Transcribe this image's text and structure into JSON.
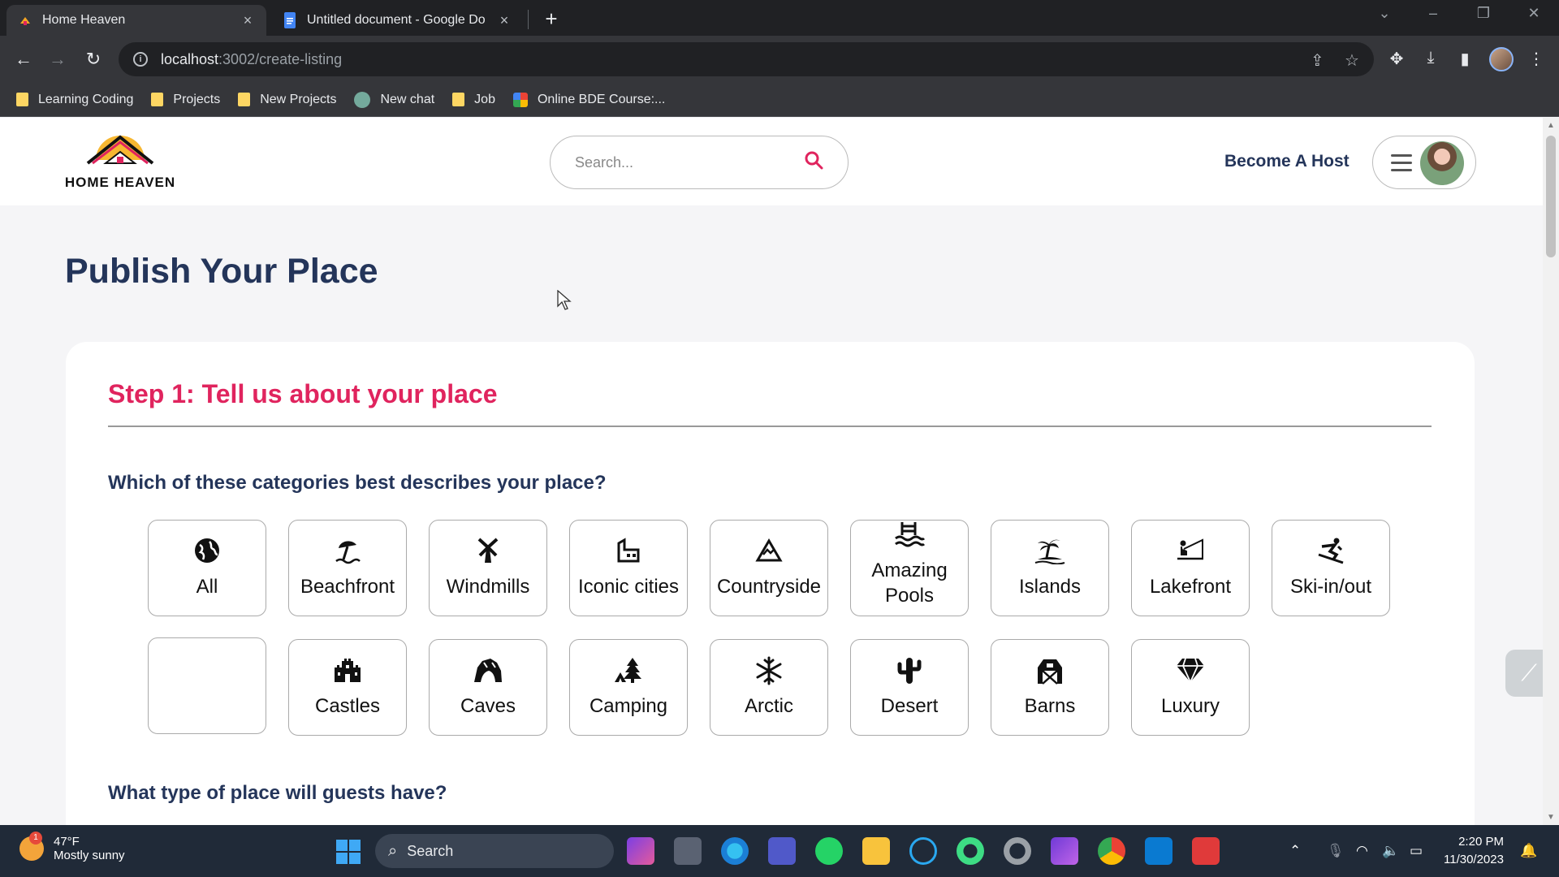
{
  "browser": {
    "tabs": [
      {
        "title": "Home Heaven",
        "active": true
      },
      {
        "title": "Untitled document - Google Do",
        "active": false
      }
    ],
    "url_host": "localhost",
    "url_path": ":3002/create-listing",
    "bookmarks": [
      {
        "label": "Learning Coding",
        "icon": "folder-icon"
      },
      {
        "label": "Projects",
        "icon": "folder-icon"
      },
      {
        "label": "New Projects",
        "icon": "folder-icon"
      },
      {
        "label": "New chat",
        "icon": "chatgpt-icon"
      },
      {
        "label": "Job",
        "icon": "folder-icon"
      },
      {
        "label": "Online BDE Course:...",
        "icon": "google-icon"
      }
    ]
  },
  "header": {
    "brand": "HOME HEAVEN",
    "search_placeholder": "Search...",
    "become_host": "Become A Host"
  },
  "page": {
    "title": "Publish Your Place",
    "step_title": "Step 1: Tell us about your place",
    "question_category": "Which of these categories best describes your place?",
    "question_type": "What type of place will guests have?"
  },
  "categories": [
    {
      "label": "All",
      "icon": "globe-icon"
    },
    {
      "label": "Beachfront",
      "icon": "beach-umbrella-icon"
    },
    {
      "label": "Windmills",
      "icon": "windmill-icon"
    },
    {
      "label": "Iconic cities",
      "icon": "city-building-icon"
    },
    {
      "label": "Countryside",
      "icon": "mountain-icon"
    },
    {
      "label": "Amazing Pools",
      "icon": "pool-ladder-icon"
    },
    {
      "label": "Islands",
      "icon": "island-palm-icon"
    },
    {
      "label": "Lakefront",
      "icon": "fishing-lake-icon"
    },
    {
      "label": "Ski-in/out",
      "icon": "skier-icon"
    },
    {
      "label": "Castles",
      "icon": "castle-icon"
    },
    {
      "label": "Caves",
      "icon": "cave-icon"
    },
    {
      "label": "Camping",
      "icon": "tent-tree-icon"
    },
    {
      "label": "Arctic",
      "icon": "snowflake-icon"
    },
    {
      "label": "Desert",
      "icon": "cactus-icon"
    },
    {
      "label": "Barns",
      "icon": "barn-icon"
    },
    {
      "label": "Luxury",
      "icon": "diamond-icon"
    }
  ],
  "taskbar": {
    "weather_temp": "47°F",
    "weather_desc": "Mostly sunny",
    "weather_badge": "1",
    "search_label": "Search",
    "time": "2:20 PM",
    "date": "11/30/2023"
  },
  "colors": {
    "accent": "#e0245e",
    "navy": "#24355a"
  }
}
